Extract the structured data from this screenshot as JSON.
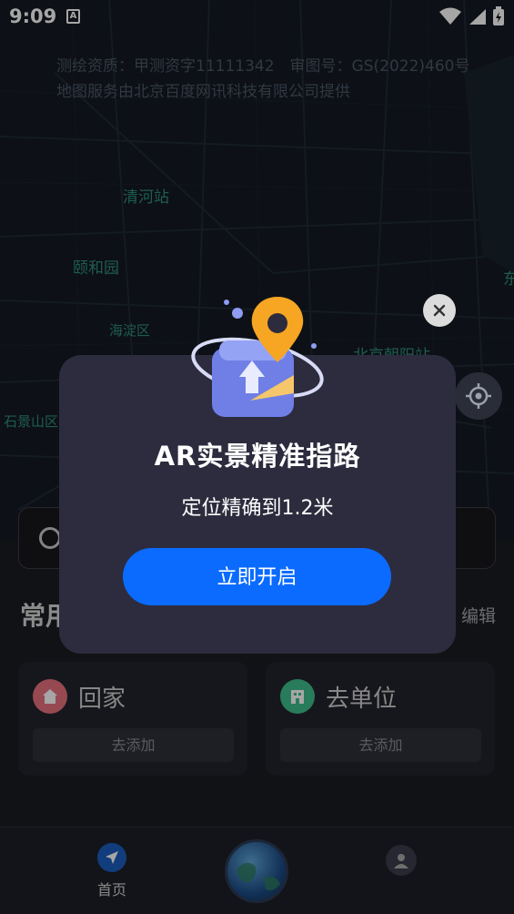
{
  "status": {
    "time": "9:09",
    "a_badge": "A"
  },
  "map": {
    "credit_line1": "测绘资质：甲测资字11111342　审图号：GS(2022)460号",
    "credit_line2": "地图服务由北京百度网讯科技有限公司提供",
    "labels": [
      "清河站",
      "颐和园",
      "海淀区",
      "石景山区",
      "北京朝阳站",
      "东"
    ]
  },
  "modal": {
    "title": "AR实景精准指路",
    "subtitle": "定位精确到1.2米",
    "button": "立即开启"
  },
  "home": {
    "section_title": "常用",
    "edit": "编辑",
    "cards": [
      {
        "title": "回家",
        "add": "去添加",
        "icon": "home-icon",
        "color": "#e8707f"
      },
      {
        "title": "去单位",
        "add": "去添加",
        "icon": "office-building-icon",
        "color": "#3fbf8c"
      }
    ]
  },
  "tabbar": {
    "home_label": "首页"
  },
  "colors": {
    "accent": "#0b6bff",
    "map_label": "#2f8f79"
  }
}
